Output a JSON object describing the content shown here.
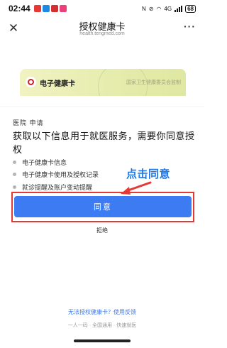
{
  "status_bar": {
    "time": "02:44",
    "notif_icons": [
      {
        "name": "red-app-icon",
        "color": "#e53935"
      },
      {
        "name": "blue-app-icon",
        "color": "#1e88e5"
      },
      {
        "name": "red-app-icon-2",
        "color": "#d32f2f"
      },
      {
        "name": "pink-app-icon",
        "color": "#ec407a"
      }
    ],
    "network": "4G",
    "battery": "68"
  },
  "nav": {
    "title": "授权健康卡",
    "subtitle": "health.tengmed.com",
    "more": "···"
  },
  "card": {
    "title": "电子健康卡",
    "issuer": "国家卫生健康委员会监制"
  },
  "consent": {
    "org": "医院 申请",
    "heading": "获取以下信息用于就医服务，需要你同意授权",
    "permissions": [
      "电子健康卡信息",
      "电子健康卡使用及授权记录",
      "就诊提醒及账户变动提醒"
    ],
    "agree_label": "同意",
    "reject_label": "拒绝"
  },
  "annotation": {
    "text": "点击同意",
    "color": "#1f79e8",
    "box_color": "#e53935"
  },
  "footer": {
    "feedback_link": "无法授权健康卡？使用反馈",
    "tagline": "一人一码 · 全国通用 · 快速就医"
  },
  "colors": {
    "primary": "#3d7bf2"
  }
}
